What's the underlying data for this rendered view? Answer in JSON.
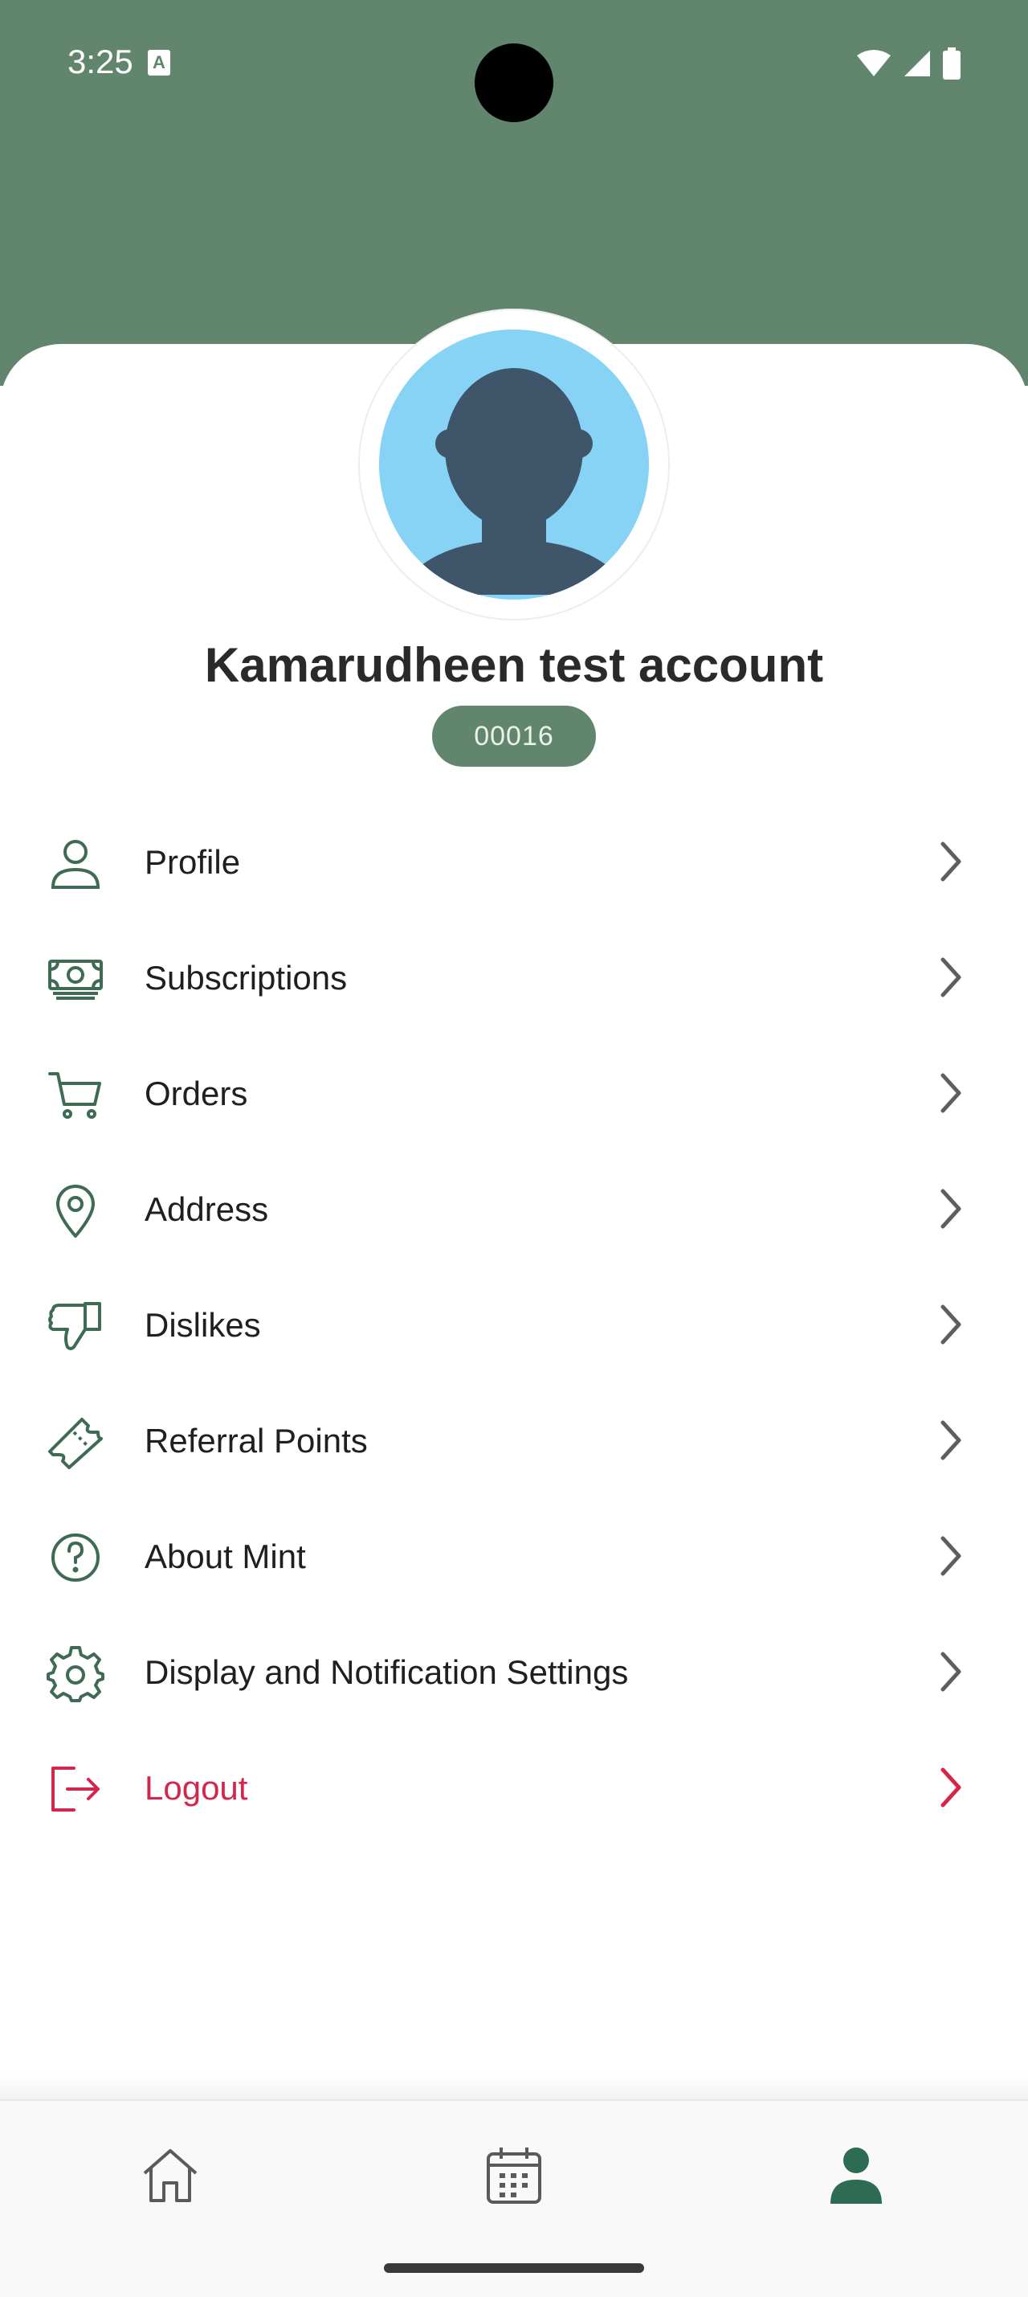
{
  "status_bar": {
    "time": "3:25",
    "a_icon": "A"
  },
  "profile": {
    "name": "Kamarudheen test account",
    "id": "00016"
  },
  "menu": [
    {
      "label": "Profile",
      "icon": "person-icon"
    },
    {
      "label": "Subscriptions",
      "icon": "money-icon"
    },
    {
      "label": "Orders",
      "icon": "cart-icon"
    },
    {
      "label": "Address",
      "icon": "location-pin-icon"
    },
    {
      "label": "Dislikes",
      "icon": "thumbs-down-icon"
    },
    {
      "label": "Referral Points",
      "icon": "ticket-icon"
    },
    {
      "label": "About Mint",
      "icon": "help-circle-icon"
    },
    {
      "label": "Display and Notification Settings",
      "icon": "gear-icon"
    },
    {
      "label": "Logout",
      "icon": "logout-icon"
    }
  ],
  "bottom_nav": [
    {
      "name": "home",
      "icon": "home-icon",
      "active": false
    },
    {
      "name": "calendar",
      "icon": "calendar-icon",
      "active": false
    },
    {
      "name": "account",
      "icon": "person-filled-icon",
      "active": true
    }
  ],
  "colors": {
    "accent": "#61866D",
    "icon": "#3F6B55",
    "logout": "#D3264D",
    "avatar_bg": "#87D3F5",
    "avatar_fg": "#3F5569",
    "nav_active": "#2E6B53",
    "nav_inactive": "#5A5A5A"
  }
}
